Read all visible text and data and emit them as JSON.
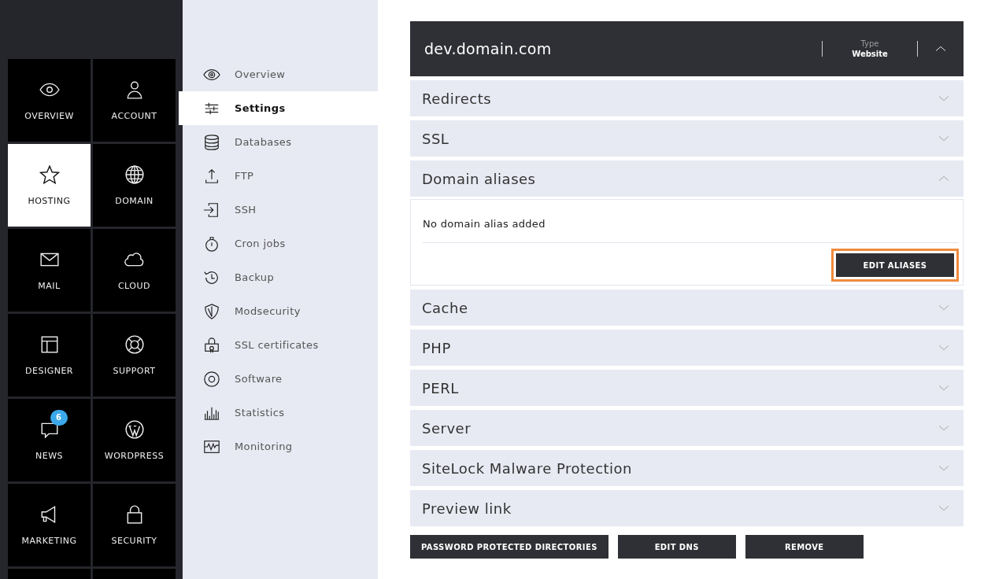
{
  "main_menu": [
    {
      "label": "OVERVIEW",
      "selected": false
    },
    {
      "label": "ACCOUNT",
      "selected": false
    },
    {
      "label": "HOSTING",
      "selected": true
    },
    {
      "label": "DOMAIN",
      "selected": false
    },
    {
      "label": "MAIL",
      "selected": false
    },
    {
      "label": "CLOUD",
      "selected": false
    },
    {
      "label": "DESIGNER",
      "selected": false
    },
    {
      "label": "SUPPORT",
      "selected": false
    },
    {
      "label": "NEWS",
      "selected": false,
      "badge": "6"
    },
    {
      "label": "WORDPRESS",
      "selected": false
    },
    {
      "label": "MARKETING",
      "selected": false
    },
    {
      "label": "SECURITY",
      "selected": false
    }
  ],
  "sub_menu": [
    {
      "label": "Overview",
      "selected": false
    },
    {
      "label": "Settings",
      "selected": true
    },
    {
      "label": "Databases",
      "selected": false
    },
    {
      "label": "FTP",
      "selected": false
    },
    {
      "label": "SSH",
      "selected": false
    },
    {
      "label": "Cron jobs",
      "selected": false
    },
    {
      "label": "Backup",
      "selected": false
    },
    {
      "label": "Modsecurity",
      "selected": false
    },
    {
      "label": "SSL certificates",
      "selected": false
    },
    {
      "label": "Software",
      "selected": false
    },
    {
      "label": "Statistics",
      "selected": false
    },
    {
      "label": "Monitoring",
      "selected": false
    }
  ],
  "domain_panel": {
    "title": "dev.domain.com",
    "type_label": "Type",
    "type_value": "Website",
    "expanded": true
  },
  "sections": [
    {
      "title": "Redirects",
      "expanded": false
    },
    {
      "title": "SSL",
      "expanded": false
    },
    {
      "title": "Domain aliases",
      "expanded": true,
      "message": "No domain alias added",
      "button": {
        "label": "EDIT ALIASES",
        "highlighted": true
      }
    },
    {
      "title": "Cache",
      "expanded": false
    },
    {
      "title": "PHP",
      "expanded": false
    },
    {
      "title": "PERL",
      "expanded": false
    },
    {
      "title": "Server",
      "expanded": false
    },
    {
      "title": "SiteLock Malware Protection",
      "expanded": false
    },
    {
      "title": "Preview link",
      "expanded": false
    }
  ],
  "actions": [
    "PASSWORD PROTECTED DIRECTORIES",
    "EDIT DNS",
    "REMOVE"
  ]
}
